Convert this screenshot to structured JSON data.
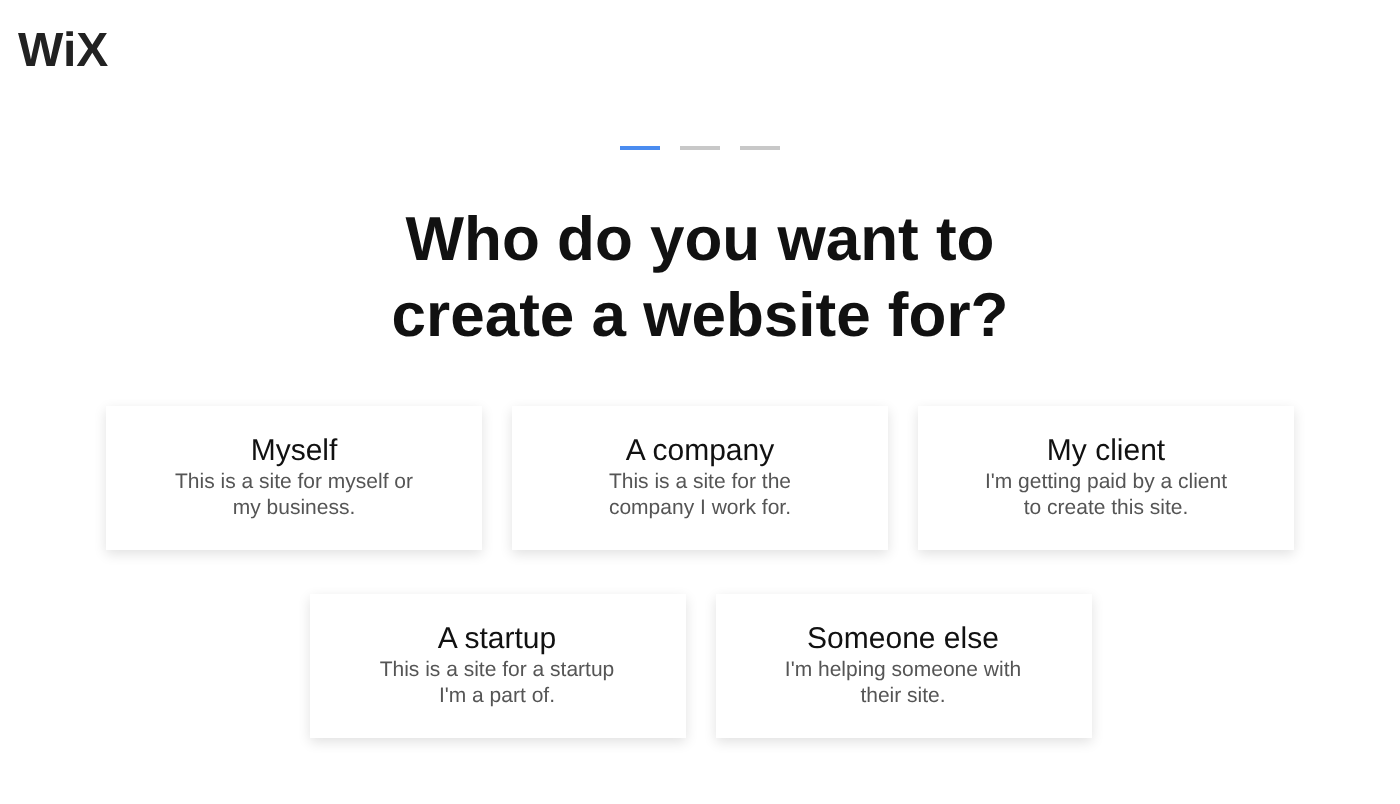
{
  "logo": "WiX",
  "steps": [
    {
      "selected": true
    },
    {
      "selected": false
    },
    {
      "selected": false
    }
  ],
  "heading": "Who do you want to\ncreate a website for?",
  "options": [
    {
      "title": "Myself",
      "description": "This is a site for myself or\nmy business."
    },
    {
      "title": "A company",
      "description": "This is a site for the\ncompany I work for."
    },
    {
      "title": "My client",
      "description": "I'm getting paid by a client\nto create this site."
    },
    {
      "title": "A startup",
      "description": "This is a site for a startup\nI'm a part of."
    },
    {
      "title": "Someone else",
      "description": "I'm helping someone with\ntheir site."
    }
  ]
}
